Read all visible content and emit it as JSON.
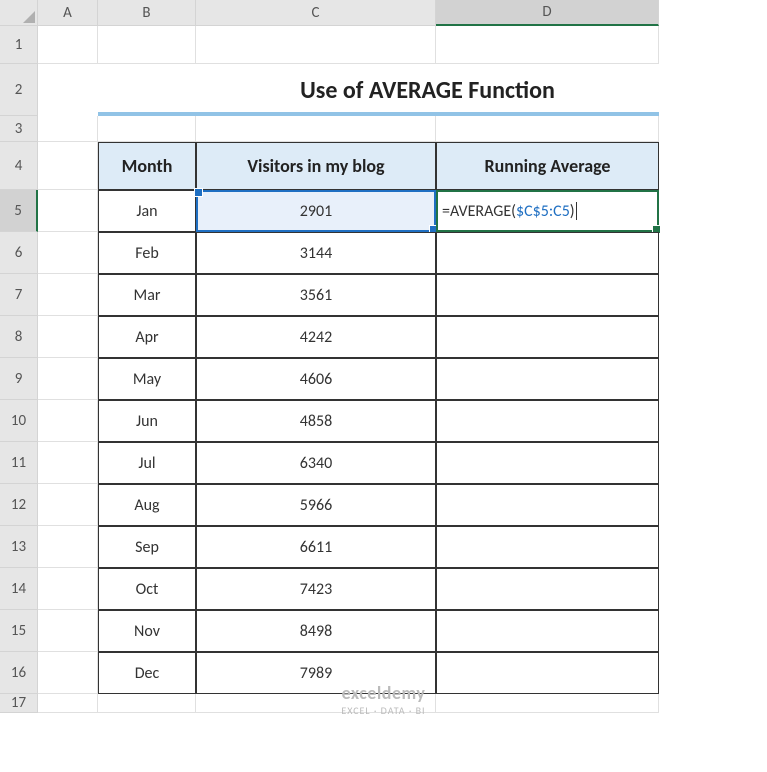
{
  "columns": [
    "A",
    "B",
    "C",
    "D"
  ],
  "rows": [
    "1",
    "2",
    "3",
    "4",
    "5",
    "6",
    "7",
    "8",
    "9",
    "10",
    "11",
    "12",
    "13",
    "14",
    "15",
    "16",
    "17"
  ],
  "title": "Use of AVERAGE Function",
  "headers": {
    "month": "Month",
    "visitors": "Visitors in my blog",
    "running": "Running Average"
  },
  "data": [
    {
      "month": "Jan",
      "visitors": "2901"
    },
    {
      "month": "Feb",
      "visitors": "3144"
    },
    {
      "month": "Mar",
      "visitors": "3561"
    },
    {
      "month": "Apr",
      "visitors": "4242"
    },
    {
      "month": "May",
      "visitors": "4606"
    },
    {
      "month": "Jun",
      "visitors": "4858"
    },
    {
      "month": "Jul",
      "visitors": "6340"
    },
    {
      "month": "Aug",
      "visitors": "5966"
    },
    {
      "month": "Sep",
      "visitors": "6611"
    },
    {
      "month": "Oct",
      "visitors": "7423"
    },
    {
      "month": "Nov",
      "visitors": "8498"
    },
    {
      "month": "Dec",
      "visitors": "7989"
    }
  ],
  "formula": {
    "prefix": "=AVERAGE(",
    "ref": "$C$5:C5",
    "suffix": ")"
  },
  "watermark": {
    "brand": "exceldemy",
    "tag": "EXCEL · DATA · BI"
  },
  "chart_data": {
    "type": "table",
    "title": "Use of AVERAGE Function",
    "columns": [
      "Month",
      "Visitors in my blog",
      "Running Average"
    ],
    "rows": [
      [
        "Jan",
        2901,
        "=AVERAGE($C$5:C5)"
      ],
      [
        "Feb",
        3144,
        ""
      ],
      [
        "Mar",
        3561,
        ""
      ],
      [
        "Apr",
        4242,
        ""
      ],
      [
        "May",
        4606,
        ""
      ],
      [
        "Jun",
        4858,
        ""
      ],
      [
        "Jul",
        6340,
        ""
      ],
      [
        "Aug",
        5966,
        ""
      ],
      [
        "Sep",
        6611,
        ""
      ],
      [
        "Oct",
        7423,
        ""
      ],
      [
        "Nov",
        8498,
        ""
      ],
      [
        "Dec",
        7989,
        ""
      ]
    ]
  }
}
